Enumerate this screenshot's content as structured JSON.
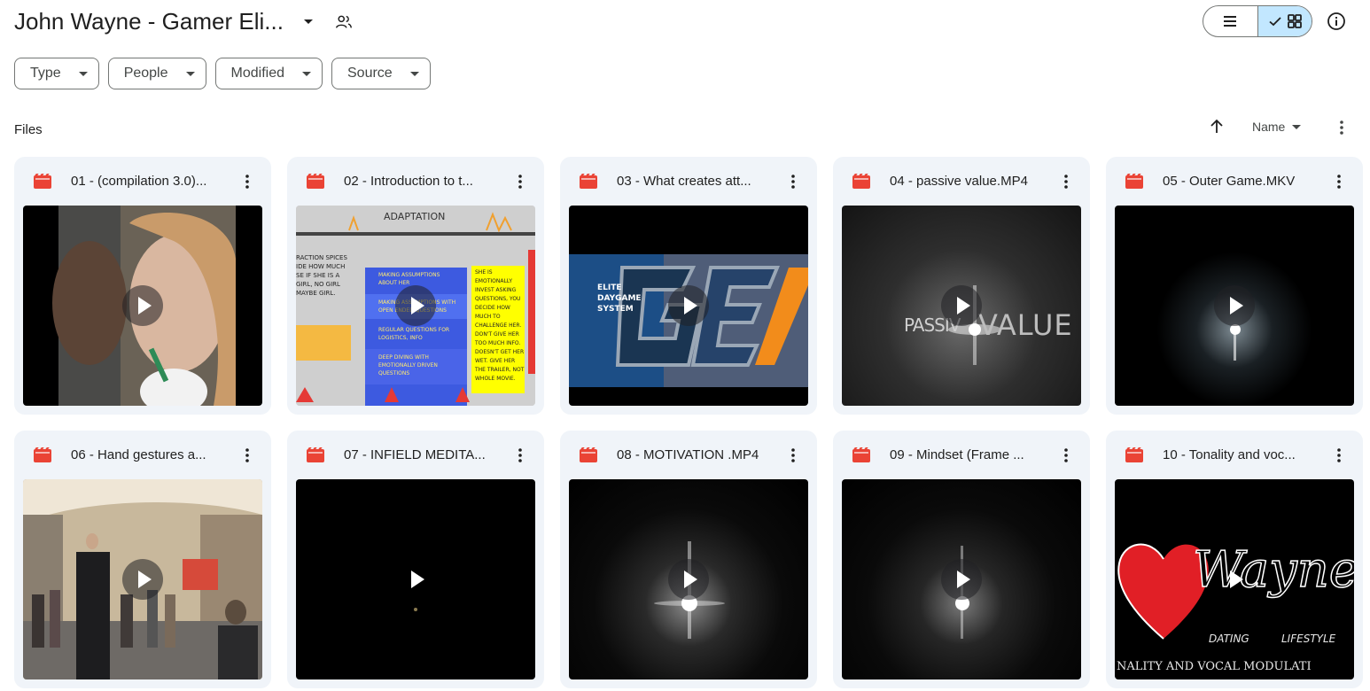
{
  "header": {
    "title": "John Wayne - Gamer Eli...",
    "title_icon": "chevron-down-icon",
    "shared_icon": "people-icon",
    "view_toggle": {
      "list_icon": "list-view-icon",
      "grid_icon": "grid-view-icon",
      "grid_check_icon": "check-icon",
      "selected": "grid"
    },
    "info_icon": "info-icon"
  },
  "filters": [
    {
      "label": "Type"
    },
    {
      "label": "People"
    },
    {
      "label": "Modified"
    },
    {
      "label": "Source"
    }
  ],
  "files_section": {
    "label": "Files",
    "sort_direction_icon": "arrow-up-icon",
    "sort_label": "Name",
    "more_icon": "more-vert-icon"
  },
  "files": [
    {
      "name": "01 - (compilation 3.0)...",
      "type_icon": "video-file-icon",
      "thumbnail": "street-selfie"
    },
    {
      "name": "02 - Introduction to t...",
      "type_icon": "video-file-icon",
      "thumbnail": "adaptation-slide",
      "thumb_texts": {
        "heading": "ADAPTATION",
        "left_a": "RACTION SPICES",
        "left_b": "IDE HOW MUCH",
        "left_c": "SE IF SHE IS A",
        "left_d": "GIRL, NO GIRL",
        "left_e": "MAYBE GIRL.",
        "box1": "MAKING ASSUMPTIONS",
        "box1b": "ABOUT HER",
        "box2": "MAKING ASSUMPTIONS WITH",
        "box2b": "OPEN ENDED QUESTIONS",
        "box3": "REGULAR QUESTIONS FOR",
        "box3b": "LOGISTICS, INFO",
        "box4": "DEEP DIVING WITH",
        "box4b": "EMOTIONALLY DRIVEN",
        "box4c": "QUESTIONS",
        "yellow1": "SHE IS",
        "yellow2": "EMOTIONALLY",
        "yellow3": "INVEST ASKING",
        "yellow4": "QUESTIONS, YOU",
        "yellow5": "DECIDE HOW",
        "yellow6": "MUCH TO",
        "yellow7": "CHALLENGE HER.",
        "yellow8": "DON'T GIVE HER",
        "yellow9": "TOO MUCH INFO.",
        "yellow10": "DOESN'T GET HER",
        "yellow11": "WET. GIVE HER",
        "yellow12": "THE TRAILER, NOT",
        "yellow13": "WHOLE MOVIE."
      }
    },
    {
      "name": "03 - What creates att...",
      "type_icon": "video-file-icon",
      "thumbnail": "ge-logo",
      "thumb_texts": {
        "line1": "ELITE",
        "line2": "DAYGAME",
        "line3": "SYSTEM",
        "logo": "GE"
      }
    },
    {
      "name": "04 - passive value.MP4",
      "type_icon": "video-file-icon",
      "thumbnail": "passive-value",
      "thumb_texts": {
        "word1": "PASSIV",
        "word2": "VALUE"
      }
    },
    {
      "name": "05 - Outer Game.MKV",
      "type_icon": "video-file-icon",
      "thumbnail": "dark-flare"
    },
    {
      "name": "06 - Hand gestures a...",
      "type_icon": "video-file-icon",
      "thumbnail": "mall-walk"
    },
    {
      "name": "07 - INFIELD MEDITA...",
      "type_icon": "video-file-icon",
      "thumbnail": "dark"
    },
    {
      "name": "08 - MOTIVATION .MP4",
      "type_icon": "video-file-icon",
      "thumbnail": "dark-flare-big"
    },
    {
      "name": "09 - Mindset (Frame ...",
      "type_icon": "video-file-icon",
      "thumbnail": "dark-flare-big"
    },
    {
      "name": "10 - Tonality and voc...",
      "type_icon": "video-file-icon",
      "thumbnail": "wayne-logo",
      "thumb_texts": {
        "script": "Wayne",
        "dating": "DATING",
        "lifestyle": "LIFESTYLE",
        "caption": "NALITY AND VOCAL MODULATI"
      }
    }
  ],
  "colors": {
    "accent": "#c2e7ff",
    "card_bg": "#f0f4f9",
    "video_icon": "#ea4335"
  }
}
